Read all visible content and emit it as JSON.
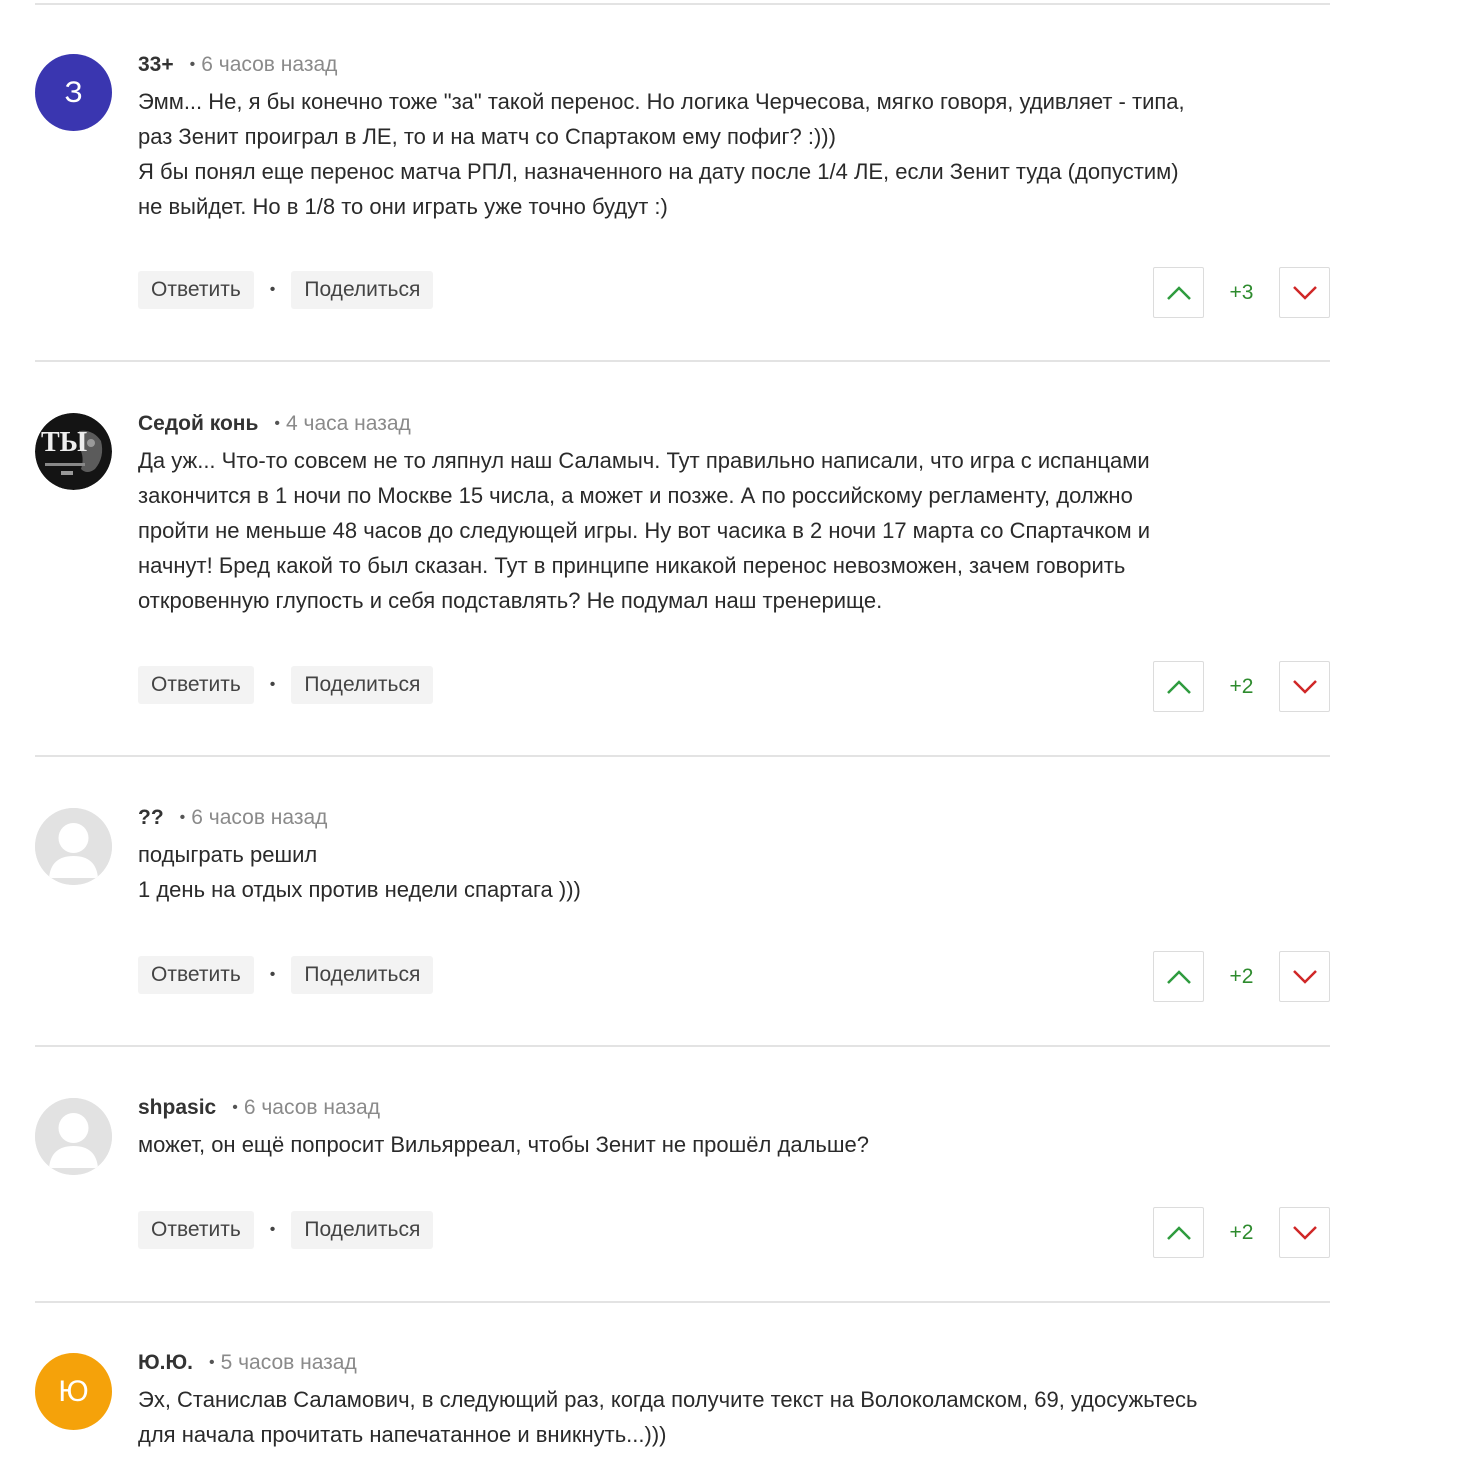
{
  "comments": [
    {
      "author": "33+",
      "time": "6 часов назад",
      "avatar_letter": "З",
      "avatar_color": "#3a36b0",
      "lines": [
        "Эмм... Не, я бы конечно тоже \"за\" такой перенос. Но логика Черчесова, мягко говоря, удивляет - типа,",
        "раз Зенит проиграл в ЛЕ, то и на матч со Спартаком ему пофиг? :)))",
        "Я бы понял еще перенос матча РПЛ, назначенного на дату после 1/4 ЛЕ, если Зенит туда (допустим)",
        "не выйдет. Но в 1/8 то они играть уже точно будут :)"
      ],
      "score": "+3",
      "reply_label": "Ответить",
      "share_label": "Поделиться"
    },
    {
      "author": "Седой конь",
      "time": "4 часа назад",
      "avatar_letter": "ТЫ",
      "avatar_color": "#111111",
      "lines": [
        "Да уж... Что-то совсем не то ляпнул наш Саламыч. Тут правильно написали, что игра с испанцами",
        "закончится в 1 ночи по Москве 15 числа, а может и позже. А по российскому регламенту, должно",
        "пройти не меньше 48 часов до следующей игры. Ну вот часика в 2 ночи 17 марта со Спартачком и",
        "начнут! Бред какой то был сказан. Тут в принципе никакой перенос невозможен, зачем говорить",
        "откровенную глупость и себя подставлять? Не подумал наш тренерище."
      ],
      "score": "+2",
      "reply_label": "Ответить",
      "share_label": "Поделиться"
    },
    {
      "author": "??",
      "time": "6 часов назад",
      "avatar_letter": "",
      "avatar_color": "#e2e2e2",
      "lines": [
        "подыграть решил",
        "1 день на отдых против недели спартага )))"
      ],
      "score": "+2",
      "reply_label": "Ответить",
      "share_label": "Поделиться"
    },
    {
      "author": "shpasic",
      "time": "6 часов назад",
      "avatar_letter": "",
      "avatar_color": "#e2e2e2",
      "lines": [
        "может, он ещё попросит Вильярреал, чтобы Зенит не прошёл дальше?"
      ],
      "score": "+2",
      "reply_label": "Ответить",
      "share_label": "Поделиться"
    },
    {
      "author": "Ю.Ю.",
      "time": "5 часов назад",
      "avatar_letter": "Ю",
      "avatar_color": "#f5a20a",
      "lines": [
        "Эх, Станислав Саламович, в следующий раз, когда получите текст на Волоколамском, 69,  удосужьтесь",
        "для начала прочитать напечатанное и вникнуть...)))"
      ]
    }
  ],
  "colors": {
    "upvote": "#2e9b3e",
    "downvote": "#d02727",
    "score": "#2e8b2e"
  }
}
